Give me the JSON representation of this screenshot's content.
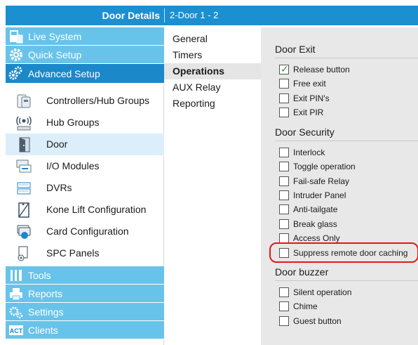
{
  "header": {
    "title": "Door Details",
    "door_name": "2-Door 1 - 2",
    "bar_color": "#1c8fd1"
  },
  "sidebar": {
    "top_items": [
      {
        "label": "Live System",
        "icon": "live-system-icon"
      },
      {
        "label": "Quick Setup",
        "icon": "quick-setup-gear-icon"
      },
      {
        "label": "Advanced Setup",
        "icon": "advanced-setup-gears-icon"
      }
    ],
    "sub_items": [
      {
        "label": "Controllers/Hub Groups",
        "icon": "controller-icon"
      },
      {
        "label": "Hub Groups",
        "icon": "hub-wireless-icon"
      },
      {
        "label": "Door",
        "icon": "door-icon"
      },
      {
        "label": "I/O Modules",
        "icon": "io-module-icon"
      },
      {
        "label": "DVRs",
        "icon": "dvr-icon"
      },
      {
        "label": "Kone Lift Configuration",
        "icon": "lift-icon"
      },
      {
        "label": "Card Configuration",
        "icon": "card-icon"
      },
      {
        "label": "SPC Panels",
        "icon": "spc-panel-icon"
      }
    ],
    "bottom_items": [
      {
        "label": "Tools",
        "icon": "tools-icon"
      },
      {
        "label": "Reports",
        "icon": "printer-icon"
      },
      {
        "label": "Settings",
        "icon": "settings-gears-icon"
      },
      {
        "label": "Clients",
        "icon": "act-logo-icon"
      }
    ],
    "light_color": "#68c3ea",
    "dark_color": "#1b88c9",
    "selected": "Door"
  },
  "tabs": [
    {
      "label": "General"
    },
    {
      "label": "Timers"
    },
    {
      "label": "Operations"
    },
    {
      "label": "AUX Relay"
    },
    {
      "label": "Reporting"
    }
  ],
  "active_tab": "Operations",
  "sections": {
    "door_exit": {
      "title": "Door Exit",
      "options": [
        {
          "label": "Release button",
          "checked": true
        },
        {
          "label": "Free exit",
          "checked": false
        },
        {
          "label": "Exit PIN's",
          "checked": false
        },
        {
          "label": "Exit PIR",
          "checked": false
        }
      ]
    },
    "door_security": {
      "title": "Door Security",
      "options": [
        {
          "label": "Interlock",
          "checked": false
        },
        {
          "label": "Toggle operation",
          "checked": false
        },
        {
          "label": "Fail-safe Relay",
          "checked": false
        },
        {
          "label": "Intruder Panel",
          "checked": false
        },
        {
          "label": "Anti-tailgate",
          "checked": false
        },
        {
          "label": "Break glass",
          "checked": false
        },
        {
          "label": "Access Only",
          "checked": false
        },
        {
          "label": "Suppress remote door caching",
          "checked": false
        }
      ]
    },
    "door_buzzer": {
      "title": "Door buzzer",
      "options": [
        {
          "label": "Silent operation",
          "checked": false
        },
        {
          "label": "Chime",
          "checked": false
        },
        {
          "label": "Guest button",
          "checked": false
        }
      ]
    }
  },
  "check_mark": "✓",
  "highlight_color": "#e0191f"
}
